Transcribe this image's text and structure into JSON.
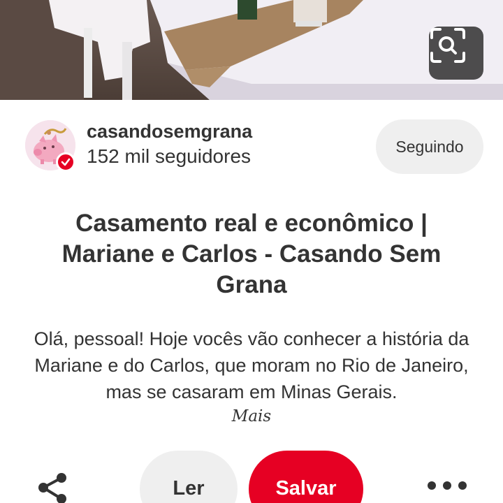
{
  "pin": {
    "photo_alt": "",
    "lens_icon": "visual-search-icon"
  },
  "profile": {
    "username": "casandosemgrana",
    "followers": "152 mil seguidores",
    "follow_label": "Seguindo",
    "verified_icon": "verified-check-icon"
  },
  "content": {
    "title": "Casamento real e econômico | Mariane e Carlos - Casando Sem Grana",
    "description": "Olá, pessoal! Hoje vocês vão conhecer a história da Mariane e do Carlos, que moram no Rio de Janeiro, mas se casaram em Minas Gerais.",
    "more_label": "Mais"
  },
  "actions": {
    "share_icon": "share-icon",
    "read_label": "Ler",
    "save_label": "Salvar",
    "more_icon": "more-options-icon"
  },
  "colors": {
    "accent": "#e60023",
    "button_gray": "#efefef",
    "text": "#333333"
  }
}
